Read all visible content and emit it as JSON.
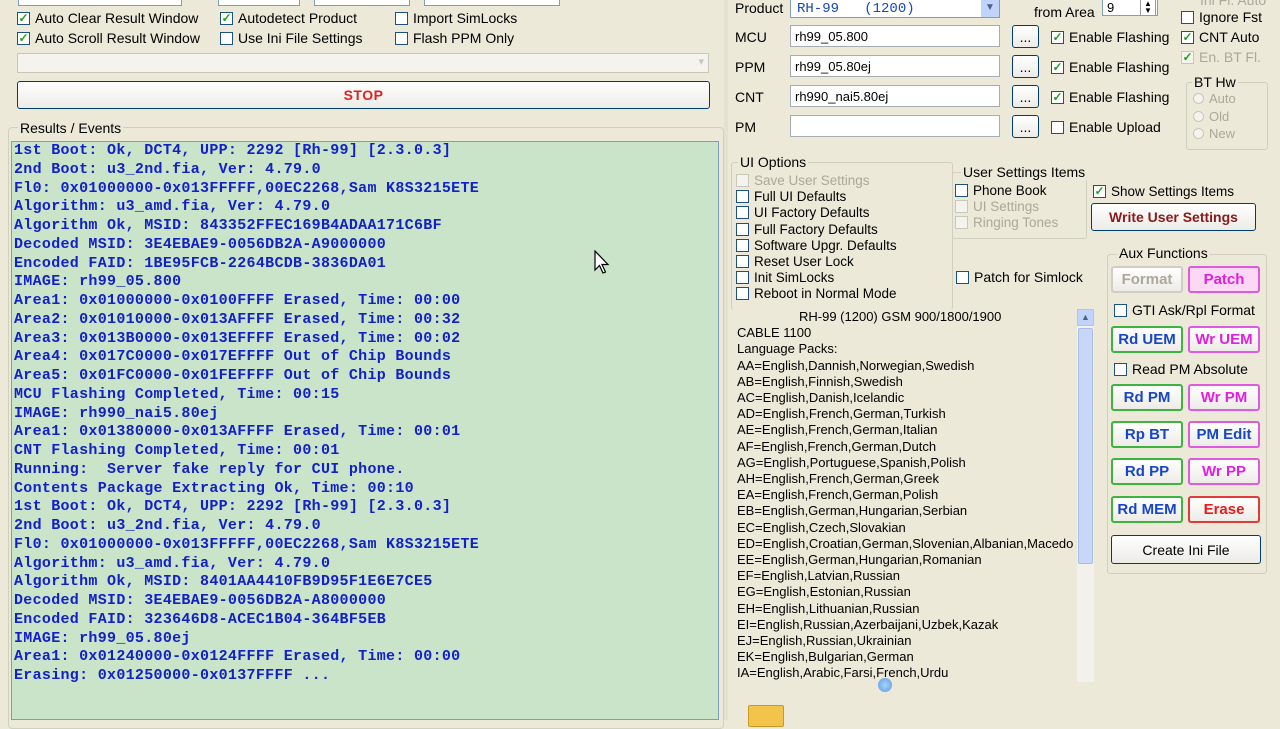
{
  "options_left": [
    {
      "label": "Auto Clear Result Window",
      "checked": true
    },
    {
      "label": "Auto Scroll Result Window",
      "checked": true
    },
    {
      "label": "Autodetect Product",
      "checked": true
    },
    {
      "label": "Use Ini File Settings",
      "checked": false
    },
    {
      "label": "Import SimLocks",
      "checked": false
    },
    {
      "label": "Flash PPM Only",
      "checked": false
    }
  ],
  "stop_label": "STOP",
  "results_title": "Results / Events",
  "log_lines": [
    "1st Boot: Ok, DCT4, UPP: 2292 [Rh-99] [2.3.0.3]",
    "2nd Boot: u3_2nd.fia, Ver: 4.79.0",
    "Fl0: 0x01000000-0x013FFFFF,00EC2268,Sam K8S3215ETE",
    "Algorithm: u3_amd.fia, Ver: 4.79.0",
    "Algorithm Ok, MSID: 843352FFEC169B4ADAA171C6BF",
    "Decoded MSID: 3E4EBAE9-0056DB2A-A9000000",
    "Encoded FAID: 1BE95FCB-2264BCDB-3836DA01",
    "IMAGE: rh99_05.800",
    "Area1: 0x01000000-0x0100FFFF Erased, Time: 00:00",
    "Area2: 0x01010000-0x013AFFFF Erased, Time: 00:32",
    "Area3: 0x013B0000-0x013EFFFF Erased, Time: 00:02",
    "Area4: 0x017C0000-0x017EFFFF Out of Chip Bounds",
    "Area5: 0x01FC0000-0x01FEFFFF Out of Chip Bounds",
    "MCU Flashing Completed, Time: 00:15",
    "IMAGE: rh990_nai5.80ej",
    "Area1: 0x01380000-0x013AFFFF Erased, Time: 00:01",
    "CNT Flashing Completed, Time: 00:01",
    "Running:  Server fake reply for CUI phone.",
    "Contents Package Extracting Ok, Time: 00:10",
    "1st Boot: Ok, DCT4, UPP: 2292 [Rh-99] [2.3.0.3]",
    "2nd Boot: u3_2nd.fia, Ver: 4.79.0",
    "Fl0: 0x01000000-0x013FFFFF,00EC2268,Sam K8S3215ETE",
    "Algorithm: u3_amd.fia, Ver: 4.79.0",
    "Algorithm Ok, MSID: 8401AA4410FB9D95F1E6E7CE5",
    "Decoded MSID: 3E4EBAE9-0056DB2A-A8000000",
    "Encoded FAID: 323646D8-ACEC1B04-364BF5EB",
    "IMAGE: rh99_05.80ej",
    "Area1: 0x01240000-0x0124FFFF Erased, Time: 00:00",
    "Erasing: 0x01250000-0x0137FFFF ..."
  ],
  "product": {
    "label": "Product",
    "value": "RH-99   (1200)"
  },
  "from_area": {
    "label": "from Area",
    "value": "9"
  },
  "file_rows": [
    {
      "label": "MCU",
      "value": "rh99_05.800",
      "browse": "...",
      "flag": "Enable Flashing",
      "checked": true
    },
    {
      "label": "PPM",
      "value": "rh99_05.80ej",
      "browse": "...",
      "flag": "Enable Flashing",
      "checked": true
    },
    {
      "label": "CNT",
      "value": "rh990_nai5.80ej",
      "browse": "...",
      "flag": "Enable Flashing",
      "checked": true
    },
    {
      "label": "PM",
      "value": "",
      "browse": "...",
      "flag": "Enable Upload",
      "checked": false
    }
  ],
  "right_checks": [
    {
      "label": "Ignore Fst",
      "checked": false,
      "disabled": false
    },
    {
      "label": "CNT Auto",
      "checked": true,
      "disabled": false
    },
    {
      "label": "En. BT Fl.",
      "checked": true,
      "disabled": true
    }
  ],
  "bt_hw": {
    "title": "BT Hw",
    "options": [
      "Auto",
      "Old",
      "New"
    ]
  },
  "ui_options": {
    "title": "UI Options",
    "items": [
      {
        "label": "Save User Settings",
        "disabled": true
      },
      {
        "label": "Full UI Defaults",
        "disabled": false
      },
      {
        "label": "UI Factory Defaults",
        "disabled": false
      },
      {
        "label": "Full Factory Defaults",
        "disabled": false
      },
      {
        "label": "Software Upgr. Defaults",
        "disabled": false
      },
      {
        "label": "Reset User Lock",
        "disabled": false
      },
      {
        "label": "Init SimLocks",
        "disabled": false
      },
      {
        "label": "Reboot in Normal Mode",
        "disabled": false
      }
    ]
  },
  "user_settings": {
    "title": "User Settings Items",
    "items": [
      {
        "label": "Phone Book",
        "disabled": false
      },
      {
        "label": "UI Settings",
        "disabled": true
      },
      {
        "label": "Ringing Tones",
        "disabled": true
      }
    ],
    "show_label": "Show Settings Items",
    "write_label": "Write User Settings"
  },
  "patch_simlock": "Patch for Simlock",
  "info_lines": [
    "RH-99 (1200) GSM 900/1800/1900",
    "CABLE 1100",
    "Language Packs:",
    "AA=English,Dannish,Norwegian,Swedish",
    "AB=English,Finnish,Swedish",
    "AC=English,Danish,Icelandic",
    "AD=English,French,German,Turkish",
    "AE=English,French,German,Italian",
    "AF=English,French,German,Dutch",
    "AG=English,Portuguese,Spanish,Polish",
    "AH=English,French,German,Greek",
    "EA=English,French,German,Polish",
    "EB=English,German,Hungarian,Serbian",
    "EC=English,Czech,Slovakian",
    "ED=English,Croatian,German,Slovenian,Albanian,Macedo",
    "EE=English,German,Hungarian,Romanian",
    "EF=English,Latvian,Russian",
    "EG=English,Estonian,Russian",
    "EH=English,Lithuanian,Russian",
    "EI=English,Russian,Azerbaijani,Uzbek,Kazak",
    "EJ=English,Russian,Ukrainian",
    "EK=English,Bulgarian,German",
    "IA=English,Arabic,Farsi,French,Urdu"
  ],
  "aux": {
    "title": "Aux Functions",
    "format": "Format",
    "patch": "Patch",
    "gti": "GTI Ask/Rpl Format",
    "rd_uem": "Rd UEM",
    "wr_uem": "Wr UEM",
    "read_pm_abs": "Read PM Absolute",
    "rd_pm": "Rd PM",
    "wr_pm": "Wr PM",
    "rp_bt": "Rp BT",
    "pm_edit": "PM Edit",
    "rd_pp": "Rd PP",
    "wr_pp": "Wr PP",
    "rd_mem": "Rd MEM",
    "erase": "Erase",
    "create_ini": "Create Ini File"
  }
}
